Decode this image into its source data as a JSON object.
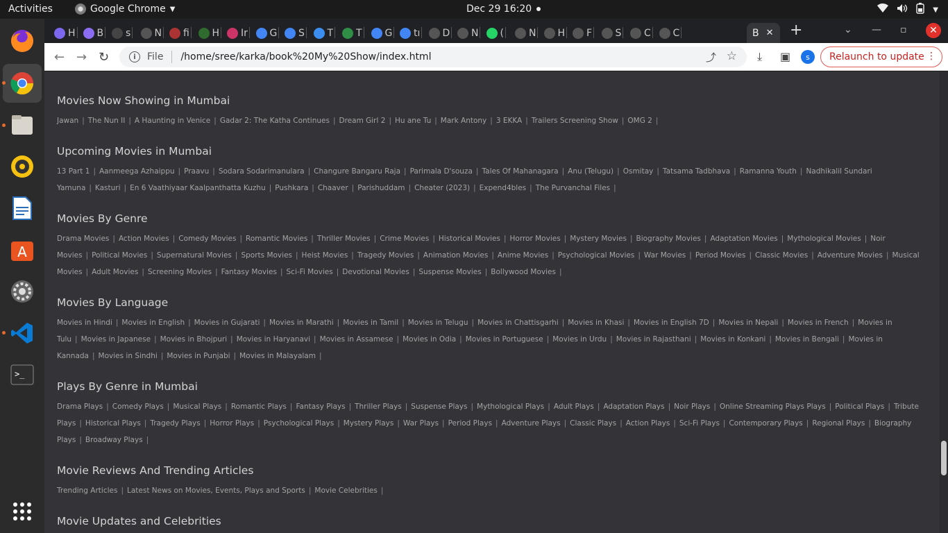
{
  "system": {
    "activities": "Activities",
    "app_name": "Google Chrome",
    "clock": "Dec 29  16:20"
  },
  "tabs": [
    {
      "label": "H",
      "color": "#7b68ee"
    },
    {
      "label": "B",
      "color": "#8c6cf0"
    },
    {
      "label": "s",
      "color": "#444444"
    },
    {
      "label": "N",
      "color": "#555555"
    },
    {
      "label": "fi",
      "color": "#aa3333"
    },
    {
      "label": "H",
      "color": "#2f6b2f"
    },
    {
      "label": "Ir",
      "color": "#cc3366"
    },
    {
      "label": "G",
      "color": "#4285f4"
    },
    {
      "label": "S",
      "color": "#4285f4"
    },
    {
      "label": "T",
      "color": "#3c8df0"
    },
    {
      "label": "T",
      "color": "#2f8d46"
    },
    {
      "label": "G",
      "color": "#4285f4"
    },
    {
      "label": "tı",
      "color": "#4285f4"
    },
    {
      "label": "D",
      "color": "#555555"
    },
    {
      "label": "N",
      "color": "#555555"
    },
    {
      "label": "(",
      "color": "#25d366"
    },
    {
      "label": "N",
      "color": "#555555"
    },
    {
      "label": "H",
      "color": "#555555"
    },
    {
      "label": "F",
      "color": "#555555"
    },
    {
      "label": "S",
      "color": "#555555"
    },
    {
      "label": "C",
      "color": "#555555"
    },
    {
      "label": "C",
      "color": "#555555"
    }
  ],
  "active_tab": {
    "label": "B"
  },
  "toolbar": {
    "scheme": "File",
    "url": "/home/sree/karka/book%20My%20Show/index.html",
    "avatar": "s",
    "relaunch": "Relaunch to update"
  },
  "sections": [
    {
      "title": "Movies Now Showing in Mumbai",
      "links": [
        "Jawan",
        "The Nun II",
        "A Haunting in Venice",
        "Gadar 2: The Katha Continues",
        "Dream Girl 2",
        "Hu ane Tu",
        "Mark Antony",
        "3 EKKA",
        "Trailers Screening Show",
        "OMG 2"
      ]
    },
    {
      "title": "Upcoming Movies in Mumbai",
      "links": [
        "13 Part 1",
        "Aanmeega Azhaippu",
        "Praavu",
        "Sodara Sodarimanulara",
        "Changure Bangaru Raja",
        "Parimala D'souza",
        "Tales Of Mahanagara",
        "Anu (Telugu)",
        "Osmitay",
        "Tatsama Tadbhava",
        "Ramanna Youth",
        "Nadhikalil Sundari Yamuna",
        "Kasturi",
        "En 6 Vaathiyaar Kaalpanthatta Kuzhu",
        "Pushkara",
        "Chaaver",
        "Parishuddam",
        "Cheater (2023)",
        "Expend4bles",
        "The Purvanchal Files"
      ]
    },
    {
      "title": "Movies By Genre",
      "links": [
        "Drama Movies",
        "Action Movies",
        "Comedy Movies",
        "Romantic Movies",
        "Thriller Movies",
        "Crime Movies",
        "Historical Movies",
        "Horror Movies",
        "Mystery Movies",
        "Biography Movies",
        "Adaptation Movies",
        "Mythological Movies",
        "Noir Movies",
        "Political Movies",
        "Supernatural Movies",
        "Sports Movies",
        "Heist Movies",
        "Tragedy Movies",
        "Animation Movies",
        "Anime Movies",
        "Psychological Movies",
        "War Movies",
        "Period Movies",
        "Classic Movies",
        "Adventure Movies",
        "Musical Movies",
        "Adult Movies",
        "Screening Movies",
        "Fantasy Movies",
        "Sci-Fi Movies",
        "Devotional Movies",
        "Suspense Movies",
        "Bollywood Movies"
      ]
    },
    {
      "title": "Movies By Language",
      "links": [
        "Movies in Hindi",
        "Movies in English",
        "Movies in Gujarati",
        "Movies in Marathi",
        "Movies in Tamil",
        "Movies in Telugu",
        "Movies in Chattisgarhi",
        "Movies in Khasi",
        "Movies in English 7D",
        "Movies in Nepali",
        "Movies in French",
        "Movies in Tulu",
        "Movies in Japanese",
        "Movies in Bhojpuri",
        "Movies in Haryanavi",
        "Movies in Assamese",
        "Movies in Odia",
        "Movies in Portuguese",
        "Movies in Urdu",
        "Movies in Rajasthani",
        "Movies in Konkani",
        "Movies in Bengali",
        "Movies in Kannada",
        "Movies in Sindhi",
        "Movies in Punjabi",
        "Movies in Malayalam"
      ]
    },
    {
      "title": "Plays By Genre in Mumbai",
      "links": [
        "Drama Plays",
        "Comedy Plays",
        "Musical Plays",
        "Romantic Plays",
        "Fantasy Plays",
        "Thriller Plays",
        "Suspense Plays",
        "Mythological Plays",
        "Adult Plays",
        "Adaptation Plays",
        "Noir Plays",
        "Online Streaming Plays Plays",
        "Political Plays",
        "Tribute Plays",
        "Historical Plays",
        "Tragedy Plays",
        "Horror Plays",
        "Psychological Plays",
        "Mystery Plays",
        "War Plays",
        "Period Plays",
        "Adventure Plays",
        "Classic Plays",
        "Action Plays",
        "Sci-Fi Plays",
        "Contemporary Plays",
        "Regional Plays",
        "Biography Plays",
        "Broadway Plays"
      ]
    },
    {
      "title": "Movie Reviews And Trending Articles",
      "links": [
        "Trending Articles",
        "Latest News on Movies, Events, Plays and Sports",
        "Movie Celebrities"
      ]
    },
    {
      "title": "Movie Updates and Celebrities",
      "links": []
    }
  ]
}
